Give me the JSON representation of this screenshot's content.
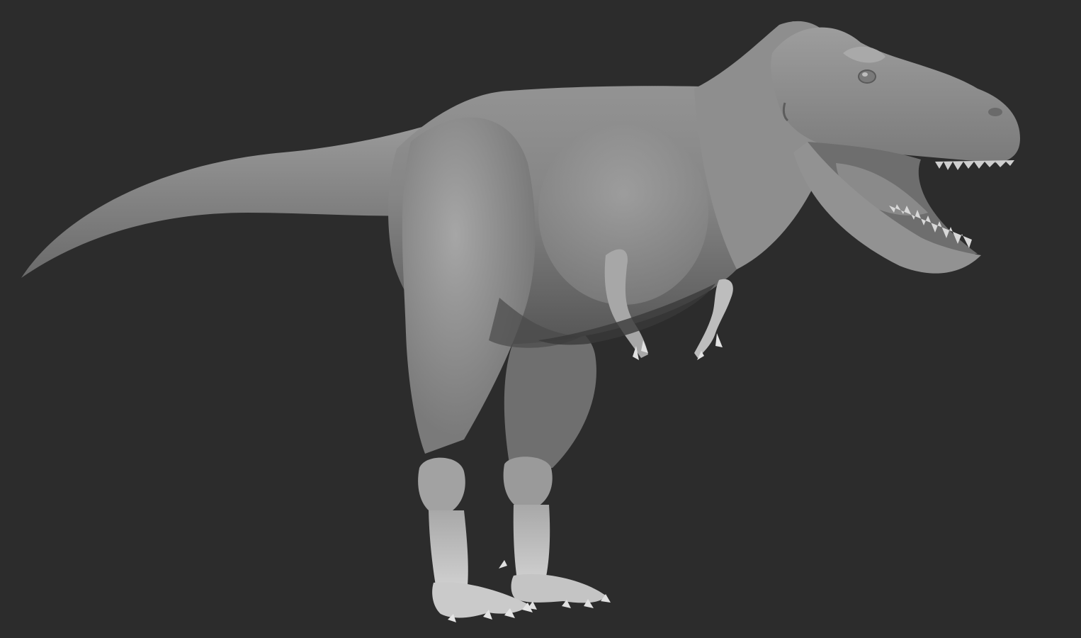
{
  "scene": {
    "subject": "tyrannosaurus-sculpt",
    "render_style": "clay-matcap-grey",
    "colors": {
      "background": "#2c2c2c",
      "clay_light": "#aaaaaa",
      "clay_mid": "#8c8c8c",
      "clay_dark": "#5a5a5a",
      "mouth_interior": "#6e6e6e",
      "teeth": "#d8d8d8",
      "claws": "#e0e0e0"
    }
  }
}
